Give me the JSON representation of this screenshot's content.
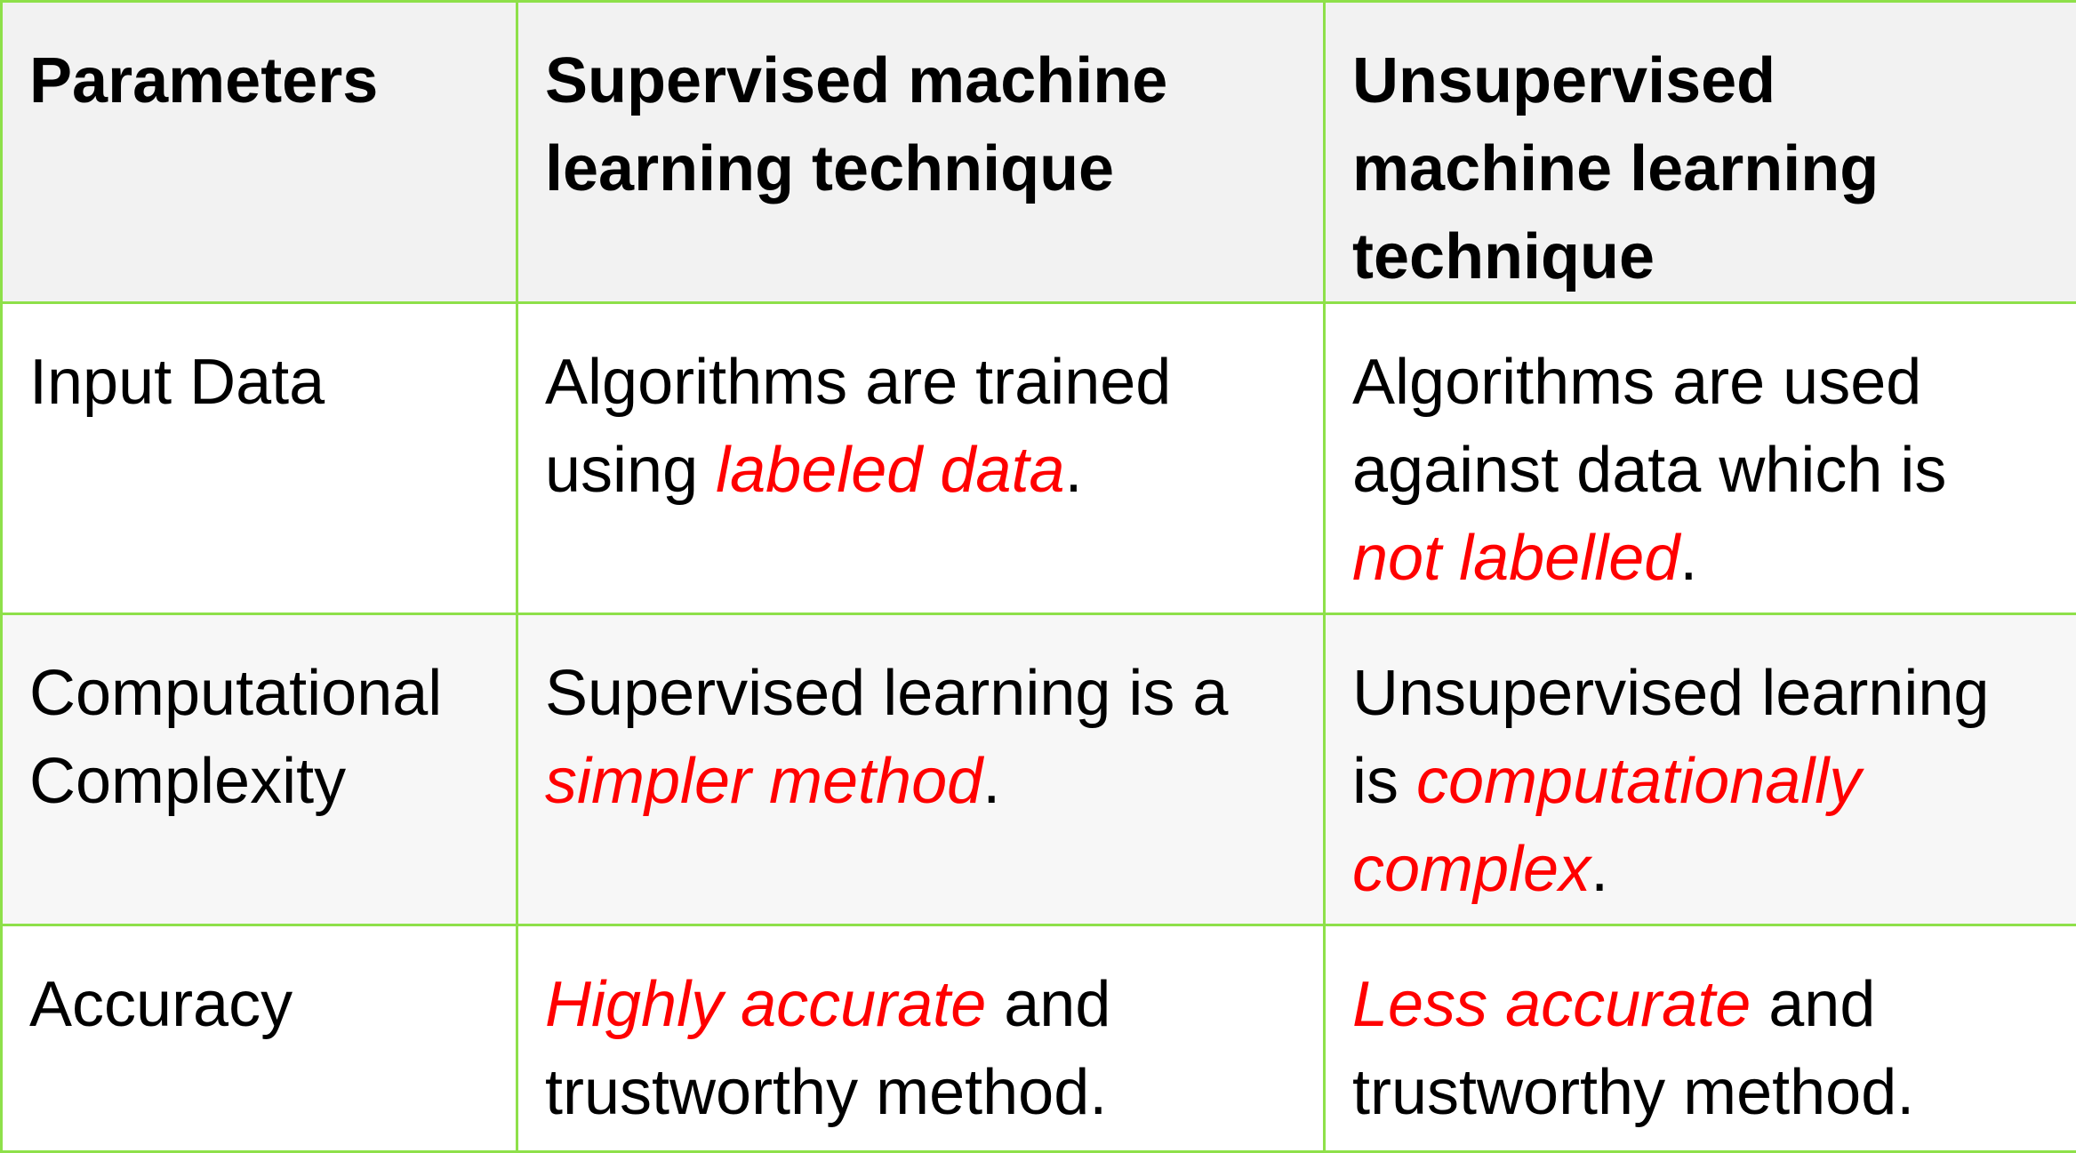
{
  "table": {
    "headers": [
      "Parameters",
      "Supervised machine learning technique",
      "Unsupervised machine learning technique"
    ],
    "rows": [
      {
        "parameter": "Input Data",
        "supervised": {
          "before": "Algorithms are trained using ",
          "highlight": "labeled data",
          "after": "."
        },
        "unsupervised": {
          "before": "Algorithms are used against data which is ",
          "highlight": "not labelled",
          "after": "."
        }
      },
      {
        "parameter": "Computational Complexity",
        "supervised": {
          "before": "Supervised learning is a ",
          "highlight": "simpler method",
          "after": "."
        },
        "unsupervised": {
          "before": "Unsupervised learning is ",
          "highlight": "computationally complex",
          "after": "."
        }
      },
      {
        "parameter": "Accuracy",
        "supervised": {
          "before": "",
          "highlight": "Highly accurate",
          "after": " and trustworthy method."
        },
        "unsupervised": {
          "before": "",
          "highlight": "Less accurate",
          "after": " and trustworthy method."
        }
      }
    ]
  },
  "colors": {
    "border": "#8ee04a",
    "highlight": "#ff0000",
    "text": "#000000"
  }
}
